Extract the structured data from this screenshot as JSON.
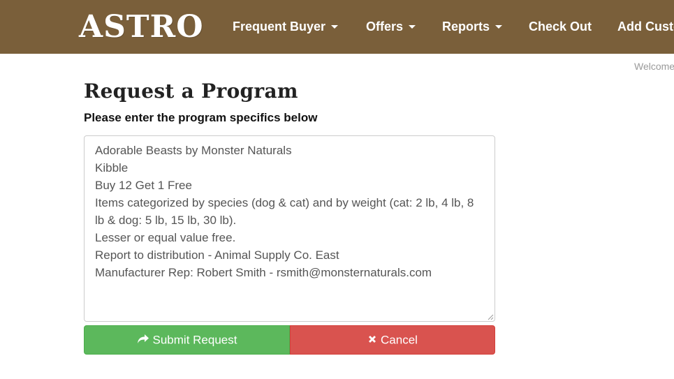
{
  "brand": {
    "logo_text": "ASTRO"
  },
  "nav": {
    "items": [
      {
        "label": "Frequent Buyer",
        "has_dropdown": true
      },
      {
        "label": "Offers",
        "has_dropdown": true
      },
      {
        "label": "Reports",
        "has_dropdown": true
      },
      {
        "label": "Check Out",
        "has_dropdown": false
      },
      {
        "label": "Add Custo",
        "has_dropdown": false
      }
    ]
  },
  "header": {
    "welcome": "Welcome"
  },
  "main": {
    "title": "Request a Program",
    "subtitle": "Please enter the program specifics below",
    "program_text": "Adorable Beasts by Monster Naturals\nKibble\nBuy 12 Get 1 Free\nItems categorized by species (dog & cat) and by weight (cat: 2 lb, 4 lb, 8 lb & dog: 5 lb, 15 lb, 30 lb).\nLesser or equal value free.\nReport to distribution - Animal Supply Co. East\nManufacturer Rep: Robert Smith - rsmith@monsternaturals.com"
  },
  "actions": {
    "submit_label": "Submit Request",
    "submit_icon": "share-arrow-icon",
    "cancel_label": "Cancel",
    "cancel_icon": "close-icon"
  },
  "colors": {
    "navbar_bg": "#7a5f3a",
    "submit_bg": "#5cb85c",
    "cancel_bg": "#d9534f"
  }
}
